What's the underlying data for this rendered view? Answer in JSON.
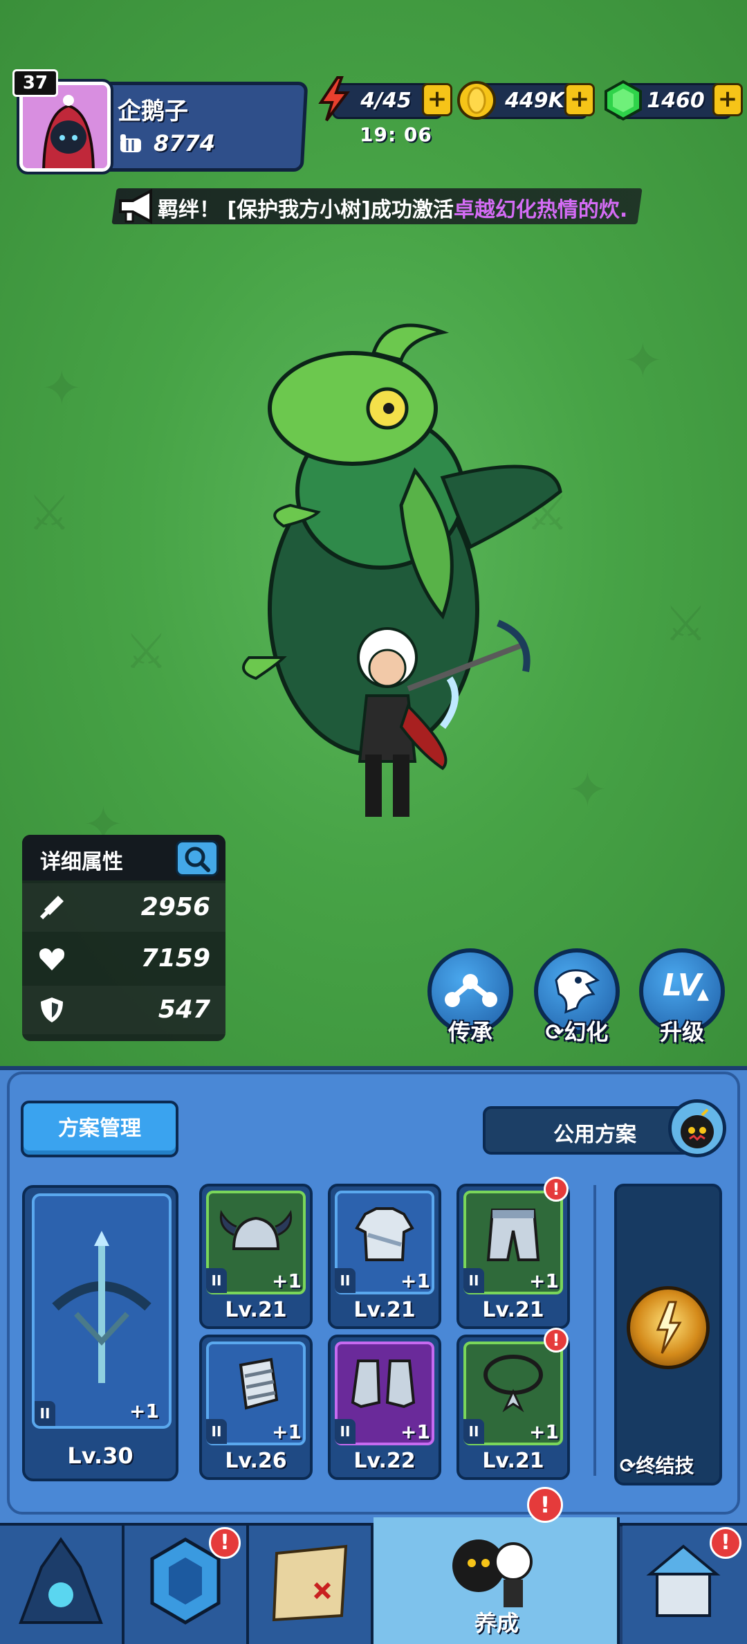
{
  "player": {
    "level": "37",
    "name": "企鹅子",
    "power": "8774"
  },
  "resources": {
    "energy": "4/45",
    "energy_timer": "19: 06",
    "gold": "449K",
    "gems": "1460",
    "plus_label": "+"
  },
  "announcement": {
    "prefix": "羁绊！ [保护我方小树]成功激活",
    "highlight": "卓越幻化热情的炊."
  },
  "stats": {
    "title": "详细属性",
    "attack": "2956",
    "health": "7159",
    "defense": "547"
  },
  "actions": {
    "inherit": "传承",
    "transform": "幻化",
    "upgrade": "升级",
    "upgrade_icon_text": "LV"
  },
  "equipment": {
    "plan_manage": "方案管理",
    "public_plan": "公用方案",
    "weapon": {
      "level": "Lv.30",
      "plus": "+1",
      "tier": "II"
    },
    "slots": [
      {
        "level": "Lv.21",
        "plus": "+1",
        "tier": "II",
        "alert": false
      },
      {
        "level": "Lv.21",
        "plus": "+1",
        "tier": "II",
        "alert": false
      },
      {
        "level": "Lv.21",
        "plus": "+1",
        "tier": "II",
        "alert": true
      },
      {
        "level": "Lv.26",
        "plus": "+1",
        "tier": "II",
        "alert": false
      },
      {
        "level": "Lv.22",
        "plus": "+1",
        "tier": "II",
        "alert": false
      },
      {
        "level": "Lv.21",
        "plus": "+1",
        "tier": "II",
        "alert": true
      }
    ],
    "ultimate_label": "终结技",
    "alert_mark": "!"
  },
  "nav": {
    "items": [
      {
        "label": ""
      },
      {
        "label": ""
      },
      {
        "label": ""
      },
      {
        "label": "养成"
      },
      {
        "label": ""
      }
    ]
  },
  "colors": {
    "background_green": "#47a346",
    "panel_blue": "#4a88d6",
    "highlight_purple": "#d46cf5",
    "alert_red": "#e53b3b",
    "gold": "#f6c418",
    "gem_green": "#2fd34a"
  }
}
